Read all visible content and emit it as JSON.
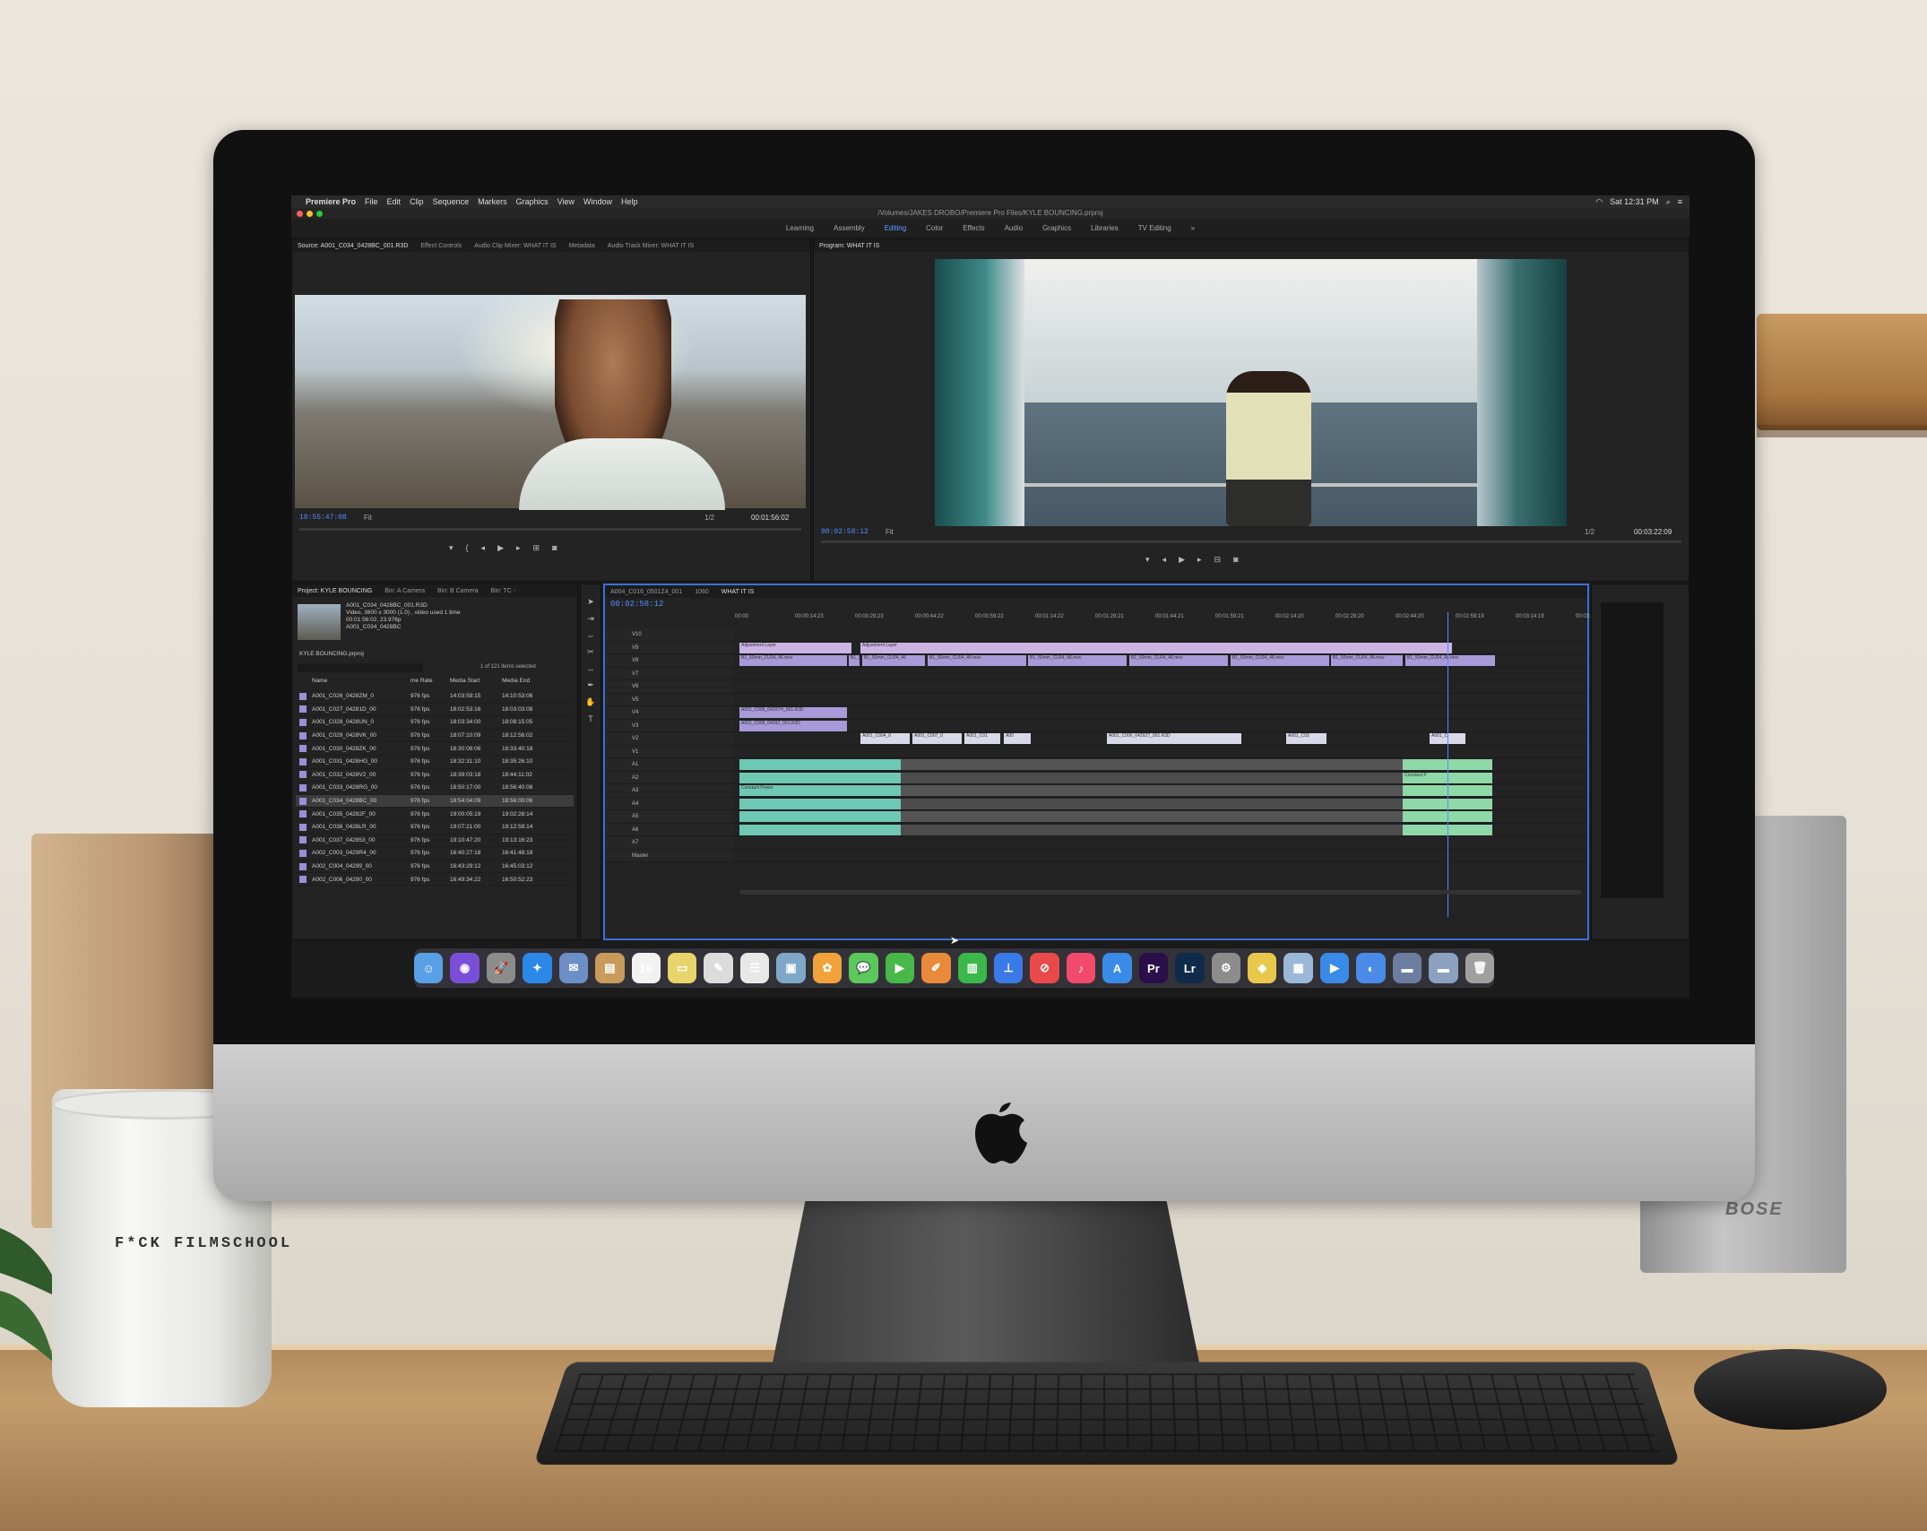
{
  "menubar": {
    "apple": "",
    "app_name": "Premiere Pro",
    "items": [
      "File",
      "Edit",
      "Clip",
      "Sequence",
      "Markers",
      "Graphics",
      "View",
      "Window",
      "Help"
    ],
    "clock": "Sat 12:31 PM"
  },
  "titlebar": {
    "path": "/Volumes/JAKES DROBO/Premiere Pro Files/KYLE BOUNCING.prproj"
  },
  "workspaces": {
    "items": [
      "Learning",
      "Assembly",
      "Editing",
      "Color",
      "Effects",
      "Audio",
      "Graphics",
      "Libraries",
      "TV Editing"
    ],
    "active": "Editing",
    "more": "»"
  },
  "source": {
    "tabs": [
      "Source: A001_C034_0428BC_001.R3D",
      "Effect Controls",
      "Audio Clip Mixer: WHAT IT IS",
      "Metadata",
      "Audio Track Mixer: WHAT IT IS"
    ],
    "timecode": "18:55:47:08",
    "fit": "Fit",
    "resolution": "1/2",
    "duration": "00:01:56:02"
  },
  "program": {
    "tab": "Program: WHAT IT IS",
    "timecode": "00:02:58:12",
    "fit": "Fit",
    "resolution": "1/2",
    "duration": "00:03:22:09"
  },
  "project": {
    "tabs": [
      "Project: KYLE BOUNCING",
      "Bin: A Camera",
      "Bin: B Camera",
      "Bin: TC -"
    ],
    "clip_name": "A001_C034_0428BC_001.R3D",
    "clip_info1": "Video, 3600 x 3000 (1.0)  , video used 1 time",
    "clip_info2": "00:01:56:02, 23.976p",
    "clip_info3": "A001_C034_0428BC",
    "file": "KYLE BOUNCING.prproj",
    "count": "1 of 121 items selected",
    "columns": [
      "Name",
      "me Rate",
      "Media Start",
      "Media End"
    ],
    "rows": [
      {
        "name": "A001_C026_0428ZM_0",
        "rate": "976 fps",
        "start": "14:03:59:15",
        "end": "14:10:53:06"
      },
      {
        "name": "A001_C027_04281D_00",
        "rate": "976 fps",
        "start": "18:02:53:16",
        "end": "18:03:03:08"
      },
      {
        "name": "A001_C028_0428UN_0",
        "rate": "976 fps",
        "start": "18:03:34:00",
        "end": "18:08:15:05"
      },
      {
        "name": "A001_C029_0428VK_00",
        "rate": "976 fps",
        "start": "18:07:10:09",
        "end": "18:12:56:02"
      },
      {
        "name": "A001_C030_0428ZK_00",
        "rate": "976 fps",
        "start": "18:30:08:06",
        "end": "18:33:40:18"
      },
      {
        "name": "A001_C031_0428HG_00",
        "rate": "976 fps",
        "start": "18:32:31:10",
        "end": "18:35:26:10"
      },
      {
        "name": "A001_C032_0428V2_00",
        "rate": "976 fps",
        "start": "18:39:03:18",
        "end": "18:44:11:02"
      },
      {
        "name": "A001_C033_0428RG_00",
        "rate": "976 fps",
        "start": "18:50:17:00",
        "end": "18:56:40:08"
      },
      {
        "name": "A001_C034_0428BC_00",
        "rate": "976 fps",
        "start": "18:54:04:09",
        "end": "18:56:00:06"
      },
      {
        "name": "A001_C035_04282F_00",
        "rate": "976 fps",
        "start": "19:00:05:19",
        "end": "19:02:28:14"
      },
      {
        "name": "A001_C036_0428LR_00",
        "rate": "976 fps",
        "start": "19:07:21:00",
        "end": "19:12:59:14"
      },
      {
        "name": "A001_C037_042853_00",
        "rate": "976 fps",
        "start": "19:10:47:20",
        "end": "19:13:16:23"
      },
      {
        "name": "A002_C003_0429R4_00",
        "rate": "976 fps",
        "start": "16:40:27:18",
        "end": "16:41:48:18"
      },
      {
        "name": "A002_C004_04299_00",
        "rate": "976 fps",
        "start": "16:43:29:12",
        "end": "16:45:03:12"
      },
      {
        "name": "A002_C006_04290_00",
        "rate": "976 fps",
        "start": "16:49:34:22",
        "end": "16:50:52:23"
      }
    ]
  },
  "timeline": {
    "tabs": [
      "A004_C016_0501Z4_001",
      "1060",
      "WHAT IT IS"
    ],
    "timecode": "00:02:58:12",
    "ruler": [
      "00:00",
      "00:00:14:23",
      "00:00:29:23",
      "00:00:44:22",
      "00:00:59:22",
      "00:01:14:22",
      "00:01:29:21",
      "00:01:44:21",
      "00:01:59:21",
      "00:02:14:20",
      "00:02:29:20",
      "00:02:44:20",
      "00:02:59:19",
      "00:03:14:19",
      "00:03:29:1"
    ],
    "video_tracks": [
      "V10",
      "V9",
      "V8",
      "V7",
      "V6",
      "V5",
      "V4",
      "V3",
      "V2",
      "V1"
    ],
    "audio_tracks": [
      "A1",
      "A2",
      "A3",
      "A4",
      "A5",
      "A6",
      "A7"
    ],
    "master": "Master",
    "master_level": "0.0",
    "clips": {
      "adjustment1": "Adjustment Layer",
      "adjustment2": "Adjustment Layer",
      "b1": "B1_50mm_CU04_46.mov",
      "b2": "B1_5",
      "b3": "B1_50mm_CU04_46",
      "b4": "B1_50mm_CU04_48.mov",
      "b5": "B1_50mm_CU04_48.mov",
      "b6": "B1_50mm_CU04_48.mov",
      "b7": "B1_50mm_CU04_48.mov",
      "b8": "B1_50mm_CU04_48.mov",
      "b9": "B1_50mm_CU04_48.mov",
      "a1": "A001_C006_0429TH_001.R3D",
      "a2": "A001_C006_0429Z_001.R3D",
      "a3": "A001_C004_0",
      "a4": "A001_C007_0",
      "a5": "A001_C01",
      "a6": "A00",
      "a7": "A001_C006_0429Z7_001.R3D",
      "a8": "A001_C03",
      "a9": "A001_C",
      "audio1": "Constant Power",
      "audio2": "Constant P"
    }
  },
  "dock": {
    "items": [
      {
        "name": "finder",
        "glyph": "☺",
        "color": "#5aa0e6"
      },
      {
        "name": "siri",
        "glyph": "◉",
        "color": "#7a4fd8"
      },
      {
        "name": "launchpad",
        "glyph": "🚀",
        "color": "#8c8c8c"
      },
      {
        "name": "safari",
        "glyph": "✦",
        "color": "#2b88e8"
      },
      {
        "name": "mail",
        "glyph": "✉",
        "color": "#6d8fc8"
      },
      {
        "name": "contacts",
        "glyph": "▤",
        "color": "#c89b5a"
      },
      {
        "name": "calendar",
        "glyph": "16",
        "color": "#f2f2f2"
      },
      {
        "name": "notes",
        "glyph": "▭",
        "color": "#e8d46a"
      },
      {
        "name": "textedit",
        "glyph": "✎",
        "color": "#dcdcdc"
      },
      {
        "name": "reminders",
        "glyph": "☰",
        "color": "#e8e8e8"
      },
      {
        "name": "preview",
        "glyph": "▣",
        "color": "#7fa7c8"
      },
      {
        "name": "photos",
        "glyph": "✿",
        "color": "#f2a23a"
      },
      {
        "name": "messages",
        "glyph": "💬",
        "color": "#5ac85a"
      },
      {
        "name": "facetime",
        "glyph": "▶",
        "color": "#48b848"
      },
      {
        "name": "pages",
        "glyph": "✐",
        "color": "#e88a3a"
      },
      {
        "name": "numbers",
        "glyph": "▥",
        "color": "#3ab84a"
      },
      {
        "name": "keynote",
        "glyph": "⊥",
        "color": "#3a7ae8"
      },
      {
        "name": "news",
        "glyph": "⊘",
        "color": "#e84a4a"
      },
      {
        "name": "music",
        "glyph": "♪",
        "color": "#f24a6a"
      },
      {
        "name": "app-store",
        "glyph": "A",
        "color": "#3a8ae8"
      },
      {
        "name": "premiere-pro",
        "glyph": "Pr",
        "color": "#2a0f4a"
      },
      {
        "name": "lightroom",
        "glyph": "Lr",
        "color": "#0f2a4a"
      },
      {
        "name": "system-preferences",
        "glyph": "⚙",
        "color": "#8c8c8c"
      },
      {
        "name": "app-folder",
        "glyph": "◈",
        "color": "#e8c84a"
      },
      {
        "name": "image-capture",
        "glyph": "▦",
        "color": "#9cb8d8"
      },
      {
        "name": "quicktime",
        "glyph": "▶",
        "color": "#3a8ae8"
      },
      {
        "name": "app-circle",
        "glyph": "◐",
        "color": "#4a8ae8"
      },
      {
        "name": "downloads",
        "glyph": "▬",
        "color": "#6c7ea0"
      },
      {
        "name": "screenshots",
        "glyph": "▬",
        "color": "#8ca0c0"
      },
      {
        "name": "trash",
        "glyph": "🗑",
        "color": "#a0a0a0"
      }
    ]
  },
  "mug": {
    "text": "F*CK FILMSCHOOL"
  },
  "speaker": {
    "brand": "BOSE"
  }
}
